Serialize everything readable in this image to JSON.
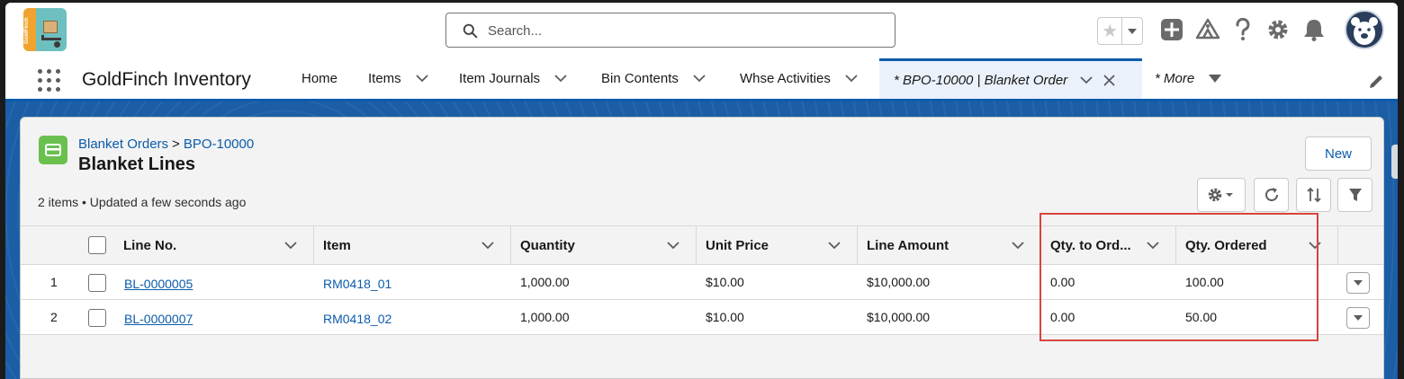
{
  "header": {
    "logo_text": "GoldFinch",
    "search_placeholder": "Search..."
  },
  "nav": {
    "app_name": "GoldFinch Inventory",
    "items": [
      {
        "label": "Home"
      },
      {
        "label": "Items"
      },
      {
        "label": "Item Journals"
      },
      {
        "label": "Bin Contents"
      },
      {
        "label": "Whse Activities"
      },
      {
        "label": "* BPO-10000 | Blanket Order"
      },
      {
        "label": "* More"
      }
    ]
  },
  "page": {
    "breadcrumb_parent": "Blanket Orders",
    "breadcrumb_sep": ">",
    "breadcrumb_current": "BPO-10000",
    "title": "Blanket Lines",
    "meta": "2 items • Updated a few seconds ago",
    "new_button": "New"
  },
  "table": {
    "columns": [
      "Line No.",
      "Item",
      "Quantity",
      "Unit Price",
      "Line Amount",
      "Qty. to Ord...",
      "Qty. Ordered"
    ],
    "rows": [
      {
        "num": "1",
        "line_no": "BL-0000005",
        "item": "RM0418_01",
        "quantity": "1,000.00",
        "unit_price": "$10.00",
        "line_amount": "$10,000.00",
        "qty_to_order": "0.00",
        "qty_ordered": "100.00"
      },
      {
        "num": "2",
        "line_no": "BL-0000007",
        "item": "RM0418_02",
        "quantity": "1,000.00",
        "unit_price": "$10.00",
        "line_amount": "$10,000.00",
        "qty_to_order": "0.00",
        "qty_ordered": "50.00"
      }
    ]
  },
  "colors": {
    "brand_blue": "#0b5cab",
    "highlight_red": "#d6453d",
    "object_icon_green": "#6ac04f"
  }
}
